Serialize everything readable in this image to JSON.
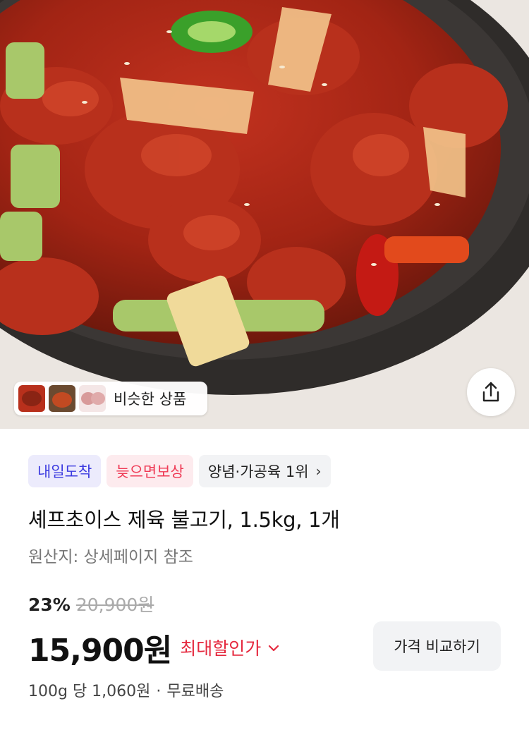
{
  "hero": {
    "similar_products_label": "비슷한 상품",
    "thumbnails": [
      "jeyuk-thumb-1",
      "jeyuk-thumb-2",
      "raw-meat-thumb"
    ],
    "share_icon": "share-icon"
  },
  "badges": {
    "arrival": "내일도착",
    "late_compensation": "늦으면보상",
    "rank": "양념·가공육 1위"
  },
  "product": {
    "title": "셰프초이스 제육 불고기, 1.5kg, 1개",
    "origin": "원산지: 상세페이지 참조"
  },
  "pricing": {
    "discount_rate": "23%",
    "original_price": "20,900원",
    "sale_price": "15,900원",
    "max_discount_label": "최대할인가",
    "compare_button": "가격 비교하기",
    "unit_price": "100g 당 1,060원",
    "shipping": "무료배송"
  },
  "colors": {
    "arrival_badge": "#3d3ce0",
    "late_badge": "#ef3a55",
    "max_discount": "#e5283e"
  }
}
